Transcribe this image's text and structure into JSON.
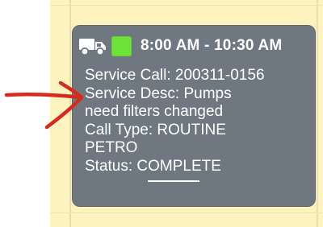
{
  "colors": {
    "calendar_background": "#fdf3bf",
    "card_background": "#6f7881",
    "status_swatch": "#6fe23a",
    "annotation_arrow": "#d72a1e",
    "text": "#ffffff"
  },
  "appointment": {
    "icon": "truck-icon",
    "status_color_name": "green",
    "time_range": "8:00 AM - 10:30 AM",
    "service_call": "Service Call: 200311-0156",
    "service_desc_line1": "Service Desc: Pumps",
    "service_desc_line2": "need filters changed",
    "call_type_line1": "Call Type: ROUTINE",
    "call_type_line2": "PETRO",
    "status_label": "Status: ",
    "status_value": "COMPLETE"
  },
  "annotation": {
    "icon": "arrow-right-icon"
  }
}
